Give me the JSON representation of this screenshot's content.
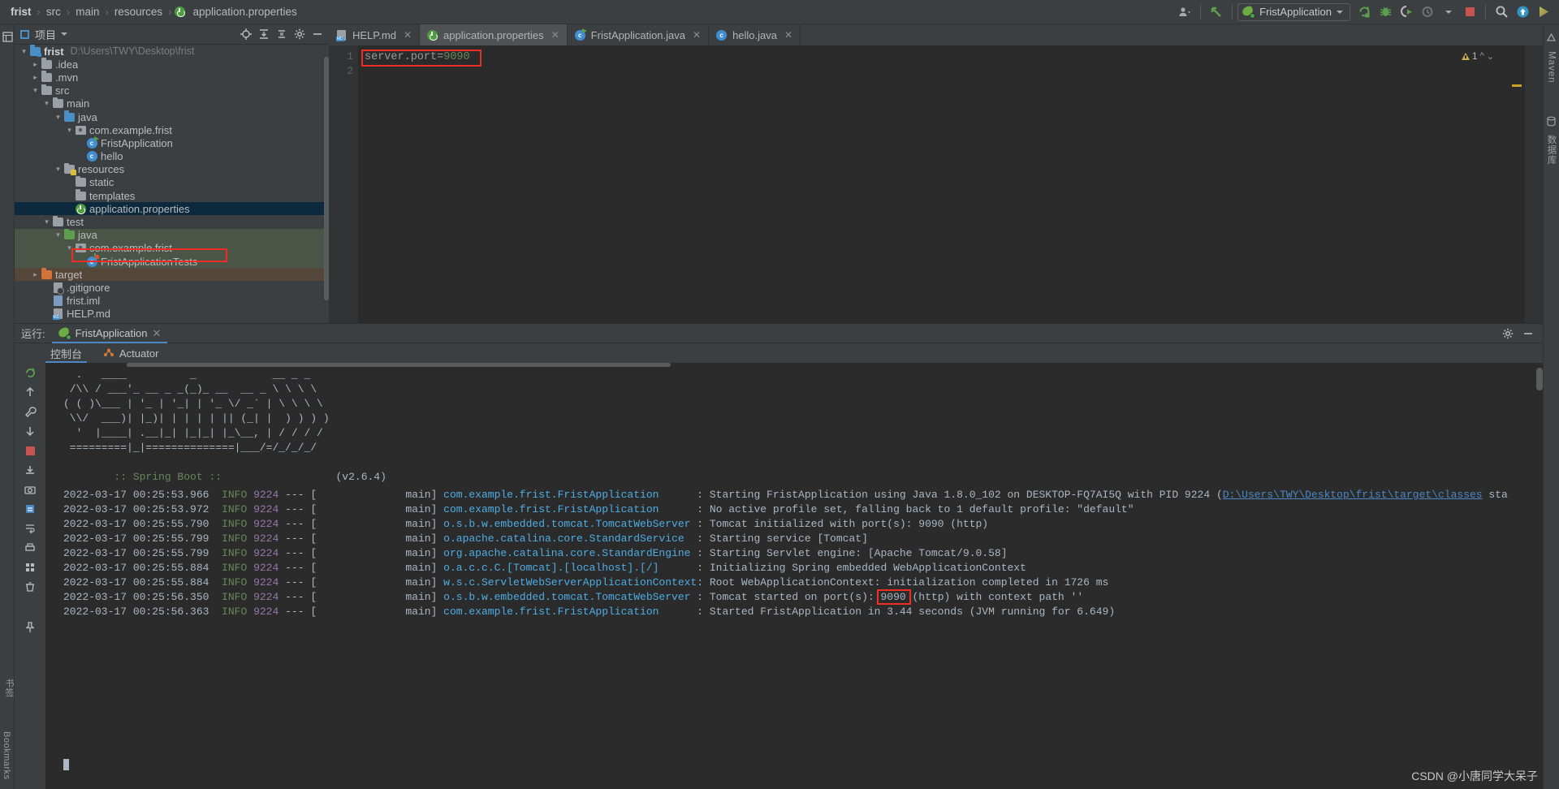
{
  "breadcrumb": {
    "items": [
      "frist",
      "src",
      "main",
      "resources",
      "application.properties"
    ],
    "separator": "›"
  },
  "toolbar": {
    "profile_icon": "user-icon",
    "update_icon": "update-arrow-icon",
    "run_config_name": "FristApplication",
    "buttons": [
      {
        "name": "rerun-icon",
        "label": "Rerun"
      },
      {
        "name": "debug-icon",
        "label": "Debug"
      },
      {
        "name": "run-with-coverage-icon",
        "label": "Run with Coverage"
      },
      {
        "name": "profiler-icon",
        "label": "Profiler"
      },
      {
        "name": "stop-icon",
        "label": "Stop"
      },
      {
        "name": "search-icon",
        "label": "Search Everywhere"
      },
      {
        "name": "update-project-icon",
        "label": "Update Project"
      },
      {
        "name": "idea-logo-icon",
        "label": "IDEA"
      }
    ]
  },
  "project_panel": {
    "title": "项目",
    "header_icons": [
      "locate-icon",
      "collapse-all-icon",
      "expand-icon",
      "settings-icon",
      "hide-icon"
    ],
    "tree": [
      {
        "label": "frist",
        "path": "D:\\Users\\TWY\\Desktop\\frist",
        "indent": 0,
        "arrow": "down",
        "icon": "module-folder",
        "bold": true
      },
      {
        "label": ".idea",
        "path": "",
        "indent": 1,
        "arrow": "right",
        "icon": "folder"
      },
      {
        "label": ".mvn",
        "path": "",
        "indent": 1,
        "arrow": "right",
        "icon": "folder"
      },
      {
        "label": "src",
        "path": "",
        "indent": 1,
        "arrow": "down",
        "icon": "folder"
      },
      {
        "label": "main",
        "path": "",
        "indent": 2,
        "arrow": "down",
        "icon": "folder"
      },
      {
        "label": "java",
        "path": "",
        "indent": 3,
        "arrow": "down",
        "icon": "source-folder"
      },
      {
        "label": "com.example.frist",
        "path": "",
        "indent": 4,
        "arrow": "down",
        "icon": "package"
      },
      {
        "label": "FristApplication",
        "path": "",
        "indent": 5,
        "arrow": "",
        "icon": "class-runnable"
      },
      {
        "label": "hello",
        "path": "",
        "indent": 5,
        "arrow": "",
        "icon": "class"
      },
      {
        "label": "resources",
        "path": "",
        "indent": 3,
        "arrow": "down",
        "icon": "resource-folder"
      },
      {
        "label": "static",
        "path": "",
        "indent": 4,
        "arrow": "",
        "icon": "folder"
      },
      {
        "label": "templates",
        "path": "",
        "indent": 4,
        "arrow": "",
        "icon": "folder"
      },
      {
        "label": "application.properties",
        "path": "",
        "indent": 4,
        "arrow": "",
        "icon": "spring-file",
        "selected": true,
        "highlighted": true
      },
      {
        "label": "test",
        "path": "",
        "indent": 2,
        "arrow": "down",
        "icon": "folder"
      },
      {
        "label": "java",
        "path": "",
        "indent": 3,
        "arrow": "down",
        "icon": "test-folder",
        "testbg": true
      },
      {
        "label": "com.example.frist",
        "path": "",
        "indent": 4,
        "arrow": "down",
        "icon": "package",
        "testbg": true
      },
      {
        "label": "FristApplicationTests",
        "path": "",
        "indent": 5,
        "arrow": "",
        "icon": "class-test",
        "testbg": true
      },
      {
        "label": "target",
        "path": "",
        "indent": 1,
        "arrow": "right",
        "icon": "target-folder",
        "targetbg": true
      },
      {
        "label": ".gitignore",
        "path": "",
        "indent": 2,
        "arrow": "",
        "icon": "gitignore-file"
      },
      {
        "label": "frist.iml",
        "path": "",
        "indent": 2,
        "arrow": "",
        "icon": "iml-file"
      },
      {
        "label": "HELP.md",
        "path": "",
        "indent": 2,
        "arrow": "",
        "icon": "markdown-file"
      }
    ]
  },
  "editor": {
    "tabs": [
      {
        "label": "HELP.md",
        "icon": "markdown-file",
        "active": false
      },
      {
        "label": "application.properties",
        "icon": "spring-file",
        "active": true
      },
      {
        "label": "FristApplication.java",
        "icon": "class-runnable",
        "active": false
      },
      {
        "label": "hello.java",
        "icon": "class",
        "active": false
      }
    ],
    "line_numbers": [
      "1",
      "2"
    ],
    "code_key": "server.port=",
    "code_value": "9090",
    "warning_count": "1"
  },
  "run_panel": {
    "label": "运行:",
    "tab_name": "FristApplication",
    "subtabs": [
      {
        "label": "控制台",
        "icon": "console-icon",
        "active": true
      },
      {
        "label": "Actuator",
        "icon": "actuator-icon",
        "active": false
      }
    ],
    "side_icons": [
      "rerun-icon",
      "wrench-icon",
      "stop-icon",
      "camera-icon",
      "thread-dump-icon",
      "export-icon",
      "print-icon",
      "grid-icon",
      "trash-icon",
      "pin-icon",
      "scroll-up-icon",
      "scroll-down-icon"
    ],
    "settings_icon": "gear-icon",
    "minimize_icon": "minimize-icon"
  },
  "console": {
    "banner": [
      "  .   ____          _            __ _ _",
      " /\\\\ / ___'_ __ _ _(_)_ __  __ _ \\ \\ \\ \\",
      "( ( )\\___ | '_ | '_| | '_ \\/ _` | \\ \\ \\ \\",
      " \\\\/  ___)| |_)| | | | | || (_| |  ) ) ) )",
      "  '  |____| .__|_| |_|_| |_\\__, | / / / /",
      " =========|_|==============|___/=/_/_/_/"
    ],
    "spring_boot_label": ":: Spring Boot ::",
    "spring_boot_version": "(v2.6.4)",
    "lines": [
      {
        "timestamp": "2022-03-17 00:25:53.966",
        "level": "INFO",
        "pid": "9224",
        "thread": "main]",
        "logger": "com.example.frist.FristApplication",
        "message": ": Starting FristApplication using Java 1.8.0_102 on DESKTOP-FQ7AI5Q with PID 9224 (",
        "link": "D:\\Users\\TWY\\Desktop\\frist\\target\\classes",
        "message_tail": " sta"
      },
      {
        "timestamp": "2022-03-17 00:25:53.972",
        "level": "INFO",
        "pid": "9224",
        "thread": "main]",
        "logger": "com.example.frist.FristApplication",
        "message": ": No active profile set, falling back to 1 default profile: \"default\""
      },
      {
        "timestamp": "2022-03-17 00:25:55.790",
        "level": "INFO",
        "pid": "9224",
        "thread": "main]",
        "logger": "o.s.b.w.embedded.tomcat.TomcatWebServer",
        "message": ": Tomcat initialized with port(s): 9090 (http)"
      },
      {
        "timestamp": "2022-03-17 00:25:55.799",
        "level": "INFO",
        "pid": "9224",
        "thread": "main]",
        "logger": "o.apache.catalina.core.StandardService",
        "message": ": Starting service [Tomcat]"
      },
      {
        "timestamp": "2022-03-17 00:25:55.799",
        "level": "INFO",
        "pid": "9224",
        "thread": "main]",
        "logger": "org.apache.catalina.core.StandardEngine",
        "message": ": Starting Servlet engine: [Apache Tomcat/9.0.58]"
      },
      {
        "timestamp": "2022-03-17 00:25:55.884",
        "level": "INFO",
        "pid": "9224",
        "thread": "main]",
        "logger": "o.a.c.c.C.[Tomcat].[localhost].[/]",
        "message": ": Initializing Spring embedded WebApplicationContext"
      },
      {
        "timestamp": "2022-03-17 00:25:55.884",
        "level": "INFO",
        "pid": "9224",
        "thread": "main]",
        "logger": "w.s.c.ServletWebServerApplicationContext",
        "message": ": Root WebApplicationContext: initialization completed in 1726 ms"
      },
      {
        "timestamp": "2022-03-17 00:25:56.350",
        "level": "INFO",
        "pid": "9224",
        "thread": "main]",
        "logger": "o.s.b.w.embedded.tomcat.TomcatWebServer",
        "message": ": Tomcat started on port(s): ",
        "highlight": "9090",
        "message_tail": " (http) with context path ''"
      },
      {
        "timestamp": "2022-03-17 00:25:56.363",
        "level": "INFO",
        "pid": "9224",
        "thread": "main]",
        "logger": "com.example.frist.FristApplication",
        "message": ": Started FristApplication in 3.44 seconds (JVM running for 6.649)"
      }
    ]
  },
  "right_strip": {
    "items": [
      "Maven",
      "数据库"
    ]
  },
  "left_strip": {
    "items": [
      "书签"
    ]
  },
  "watermark": "CSDN @小唐同学大呆子",
  "colors": {
    "accent_blue": "#4a88c7",
    "selection": "#0d293e",
    "annotation_red": "#ee2e24",
    "green": "#6a8759",
    "cyan": "#4eade5",
    "purple": "#9876aa"
  }
}
